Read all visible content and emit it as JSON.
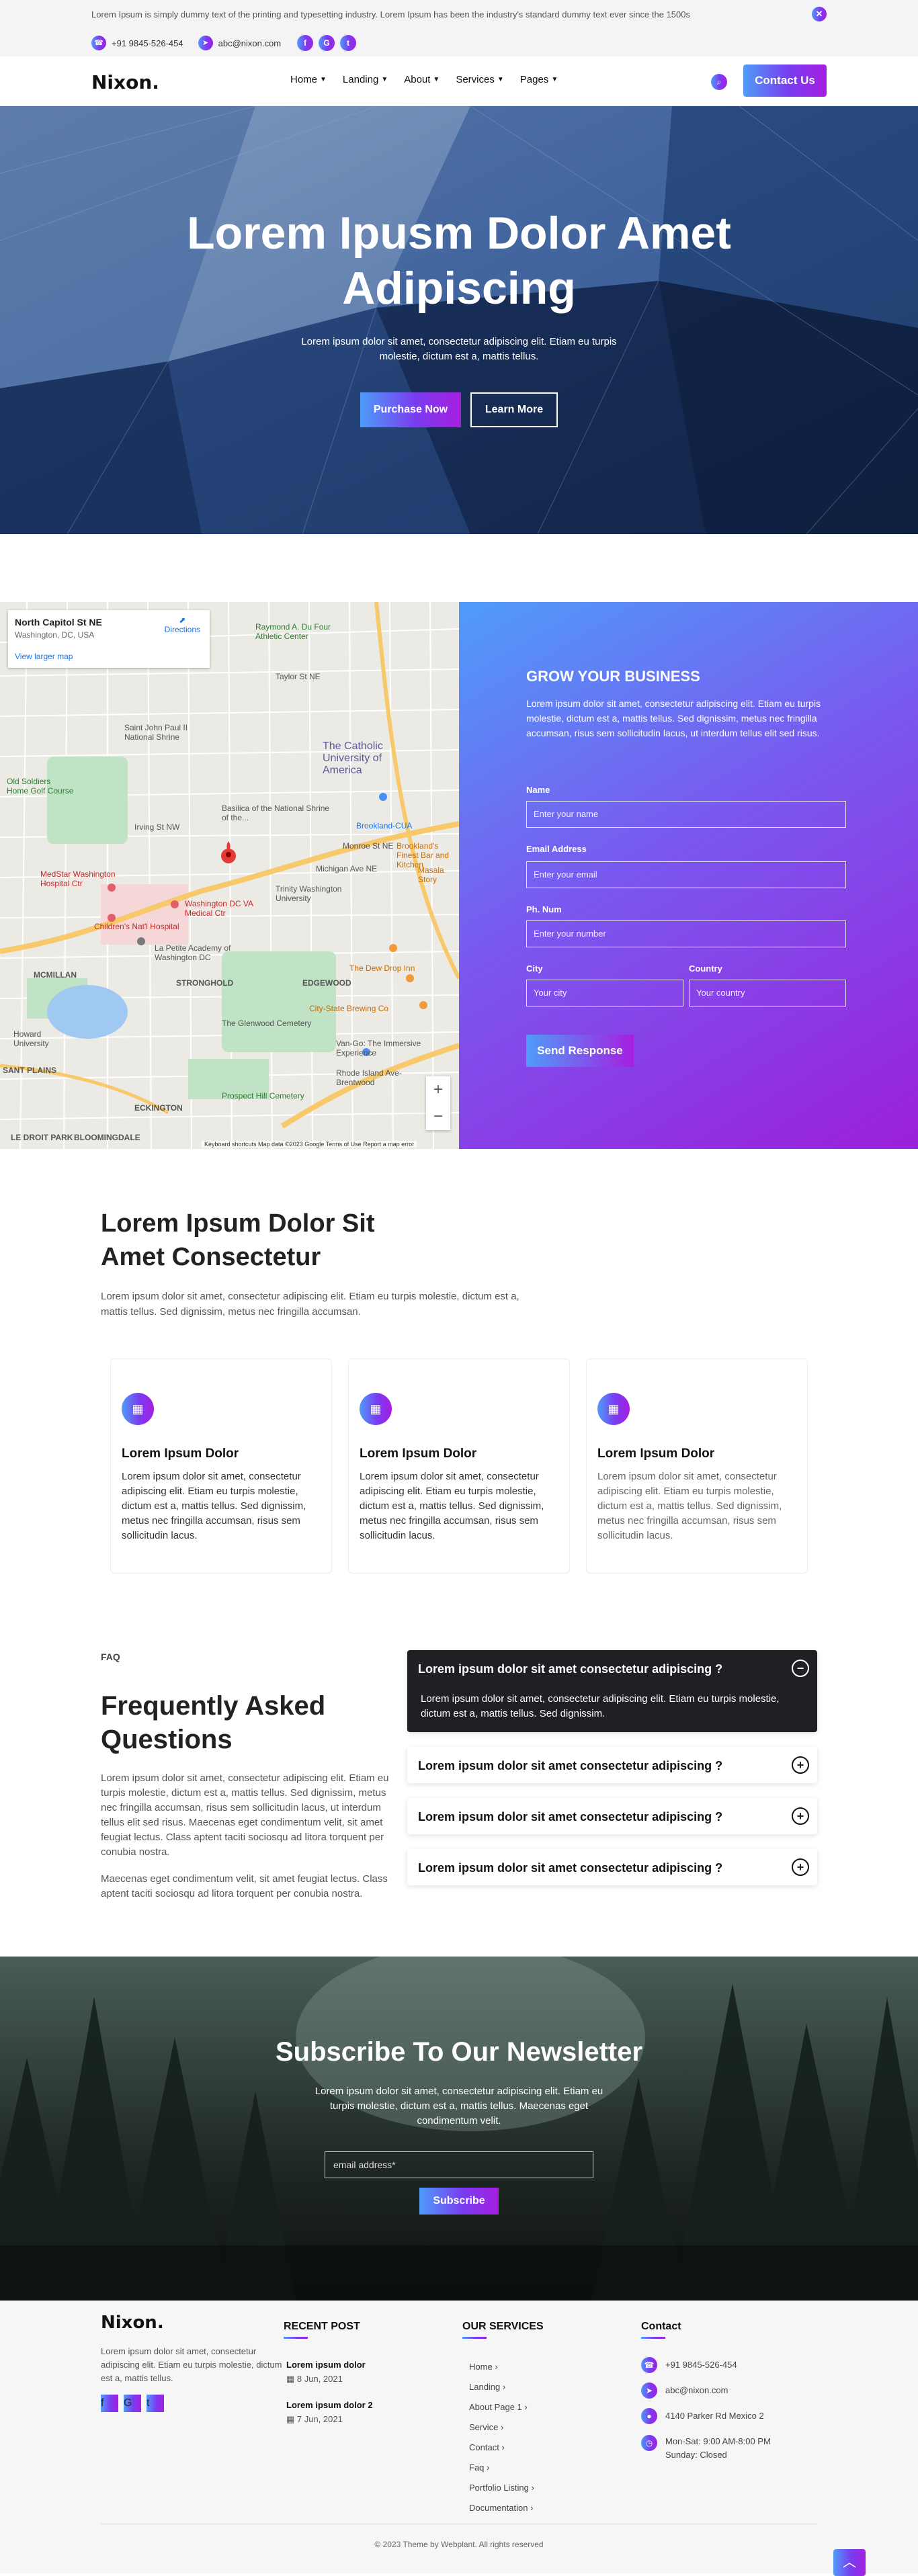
{
  "topbar": {
    "notice": "Lorem Ipsum is simply dummy text of the printing and typesetting industry. Lorem Ipsum has been the industry's standard dummy text ever since the 1500s",
    "close_icon": "close-icon",
    "phone": "+91 9845-526-454",
    "email": "abc@nixon.com",
    "social": [
      "facebook-icon",
      "google-icon",
      "twitter-icon"
    ]
  },
  "nav": {
    "logo": "Nixon.",
    "items": [
      {
        "label": "Home"
      },
      {
        "label": "Landing"
      },
      {
        "label": "About"
      },
      {
        "label": "Services"
      },
      {
        "label": "Pages"
      }
    ],
    "contact_button": "Contact Us"
  },
  "hero": {
    "title_line1": "Lorem Ipusm Dolor Amet",
    "title_line2": "Adipiscing",
    "subtitle": "Lorem ipsum dolor sit amet, consectetur adipiscing elit. Etiam eu turpis molestie, dictum est a, mattis tellus.",
    "primary_button": "Purchase Now",
    "secondary_button": "Learn More"
  },
  "map": {
    "place": "North Capitol St NE",
    "place_sub": "Washington, DC, USA",
    "directions": "Directions",
    "larger_map": "View larger map",
    "labels": [
      "Saint John Paul II National Shrine",
      "The Catholic University of America",
      "Basilica of the National Shrine of the...",
      "MedStar Washington Hospital Ctr",
      "Children's Nat'l Hospital",
      "Washington DC VA Medical Ctr",
      "Trinity Washington University",
      "La Petite Academy of Washington DC",
      "STRONGHOLD",
      "EDGEWOOD",
      "MCMILLAN",
      "Howard University",
      "The Glenwood Cemetery",
      "Brookland's Finest Bar and Kitchen",
      "The Dew Drop Inn",
      "City-State Brewing Co",
      "Van-Go: The Immersive Experience",
      "Rhode Island Ave-Brentwood",
      "Old Soldiers Home Golf Course",
      "Prospect Hill Cemetery",
      "ECKINGTON",
      "BLOOMINGDALE",
      "Raymond A. Du Four Athletic Center",
      "Brookland-CUA",
      "Masala Story",
      "Taylor St NE",
      "Irving St NW",
      "Monroe St NE",
      "Michigan Ave NE",
      "SANT PLAINS",
      "LE DROIT PARK"
    ],
    "footer": "Keyboard shortcuts   Map data ©2023 Google   Terms of Use   Report a map error",
    "zoom_in": "+",
    "zoom_out": "−"
  },
  "form": {
    "title": "GROW YOUR BUSINESS",
    "description": "Lorem ipsum dolor sit amet, consectetur adipiscing elit. Etiam eu turpis molestie, dictum est a, mattis tellus. Sed dignissim, metus nec fringilla accumsan, risus sem sollicitudin lacus, ut interdum tellus elit sed risus.",
    "name_label": "Name",
    "name_placeholder": "Enter your name",
    "email_label": "Email Address",
    "email_placeholder": "Enter your email",
    "phone_label": "Ph. Num",
    "phone_placeholder": "Enter your number",
    "city_label": "City",
    "city_placeholder": "Your city",
    "country_label": "Country",
    "country_placeholder": "Your country",
    "submit": "Send Response"
  },
  "features": {
    "title_line1": "Lorem Ipsum Dolor Sit",
    "title_line2": "Amet Consectetur",
    "description": "Lorem ipsum dolor sit amet, consectetur adipiscing elit. Etiam eu turpis molestie, dictum est a, mattis tellus. Sed dignissim, metus nec fringilla accumsan.",
    "cards": [
      {
        "title": "Lorem Ipsum Dolor",
        "text": "Lorem ipsum dolor sit amet, consectetur adipiscing elit. Etiam eu turpis molestie, dictum est a, mattis tellus. Sed dignissim, metus nec fringilla accumsan, risus sem sollicitudin lacus."
      },
      {
        "title": "Lorem Ipsum Dolor",
        "text": "Lorem ipsum dolor sit amet, consectetur adipiscing elit. Etiam eu turpis molestie, dictum est a, mattis tellus. Sed dignissim, metus nec fringilla accumsan, risus sem sollicitudin lacus."
      },
      {
        "title": "Lorem Ipsum Dolor",
        "text": "Lorem ipsum dolor sit amet, consectetur adipiscing elit. Etiam eu turpis molestie, dictum est a, mattis tellus. Sed dignissim, metus nec fringilla accumsan, risus sem sollicitudin lacus."
      }
    ]
  },
  "faq": {
    "tag": "FAQ",
    "title": "Frequently Asked Questions",
    "paragraph1": "Lorem ipsum dolor sit amet, consectetur adipiscing elit. Etiam eu turpis molestie, dictum est a, mattis tellus. Sed dignissim, metus nec fringilla accumsan, risus sem sollicitudin lacus, ut interdum tellus elit sed risus. Maecenas eget condimentum velit, sit amet feugiat lectus. Class aptent taciti sociosqu ad litora torquent per conubia nostra.",
    "paragraph2": "Maecenas eget condimentum velit, sit amet feugiat lectus. Class aptent taciti sociosqu ad litora torquent per conubia nostra.",
    "items": [
      {
        "question": "Lorem ipsum dolor sit amet consectetur adipiscing ?",
        "answer": "Lorem ipsum dolor sit amet, consectetur adipiscing elit. Etiam eu turpis molestie, dictum est a, mattis tellus. Sed dignissim.",
        "toggle": "−"
      },
      {
        "question": "Lorem ipsum dolor sit amet consectetur adipiscing ?",
        "toggle": "+"
      },
      {
        "question": "Lorem ipsum dolor sit amet consectetur adipiscing ?",
        "toggle": "+"
      },
      {
        "question": "Lorem ipsum dolor sit amet consectetur adipiscing ?",
        "toggle": "+"
      }
    ]
  },
  "newsletter": {
    "title": "Subscribe To Our Newsletter",
    "description": "Lorem ipsum dolor sit amet, consectetur adipiscing elit. Etiam eu turpis molestie, dictum est a, mattis tellus. Maecenas eget condimentum velit.",
    "placeholder": "email address*",
    "button": "Subscribe"
  },
  "footer": {
    "logo": "Nixon.",
    "description": "Lorem ipsum dolor sit amet, consectetur adipiscing elit. Etiam eu turpis molestie, dictum est a, mattis tellus.",
    "recent_post_heading": "RECENT POST",
    "posts": [
      {
        "title": "Lorem ipsum dolor",
        "date": "8 Jun, 2021"
      },
      {
        "title": "Lorem ipsum dolor 2",
        "date": "7 Jun, 2021"
      }
    ],
    "services_heading": "OUR SERVICES",
    "services": [
      "Home",
      "Landing",
      "About Page 1",
      "Service",
      "Contact",
      "Faq",
      "Portfolio Listing",
      "Documentation"
    ],
    "contact_heading": "Contact",
    "phone": "+91 9845-526-454",
    "email": "abc@nixon.com",
    "address": "4140 Parker Rd Mexico 2",
    "hours": "Mon-Sat: 9:00 AM-8:00 PM Sunday: Closed",
    "copyright": "© 2023 Theme by Webplant. All rights reserved"
  },
  "colors": {
    "gradient_start": "#4f9cf9",
    "gradient_mid": "#7a3cf0",
    "gradient_end": "#a51fe0",
    "dark": "#1f2024"
  }
}
